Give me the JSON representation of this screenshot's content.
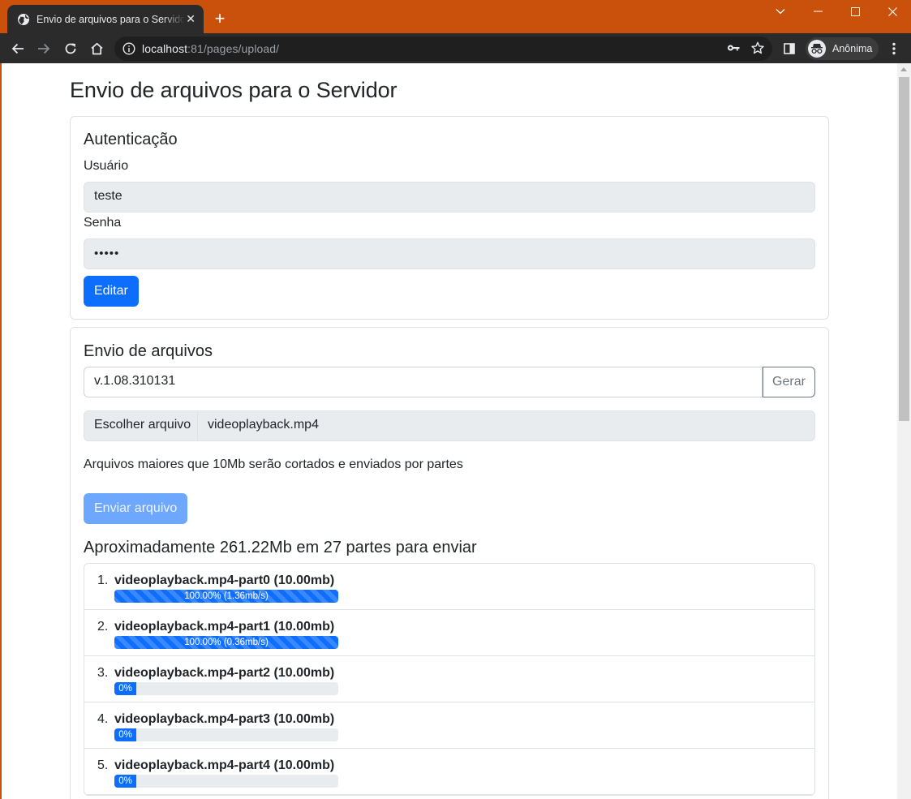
{
  "browser": {
    "tab_title": "Envio de arquivos para o Servidor",
    "tab_close": "✕",
    "new_tab": "+",
    "url_host": "localhost",
    "url_rest": ":81/pages/upload/",
    "profile_label": "Anônima",
    "theme_color": "#c9510c"
  },
  "page": {
    "title": "Envio de arquivos para o Servidor"
  },
  "auth": {
    "heading": "Autenticação",
    "user_label": "Usuário",
    "user_value": "teste",
    "password_label": "Senha",
    "password_value": "•••••",
    "edit_button": "Editar"
  },
  "upload": {
    "heading": "Envio de arquivos",
    "version_value": "v.1.08.310131",
    "generate_button": "Gerar",
    "choose_file_button": "Escolher arquivo",
    "file_name": "videoplayback.mp4",
    "help_text": "Arquivos maiores que 10Mb serão cortados e enviados por partes",
    "send_button": "Enviar arquivo",
    "summary": "Aproximadamente 261.22Mb em 27 partes para enviar",
    "parts": [
      {
        "num": "1.",
        "name": "videoplayback.mp4-part0 (10.00mb)",
        "progress": 100,
        "progress_label": "100.00% (1.36mb/s)"
      },
      {
        "num": "2.",
        "name": "videoplayback.mp4-part1 (10.00mb)",
        "progress": 100,
        "progress_label": "100.00% (0.36mb/s)"
      },
      {
        "num": "3.",
        "name": "videoplayback.mp4-part2 (10.00mb)",
        "progress": 0,
        "progress_label": "0%"
      },
      {
        "num": "4.",
        "name": "videoplayback.mp4-part3 (10.00mb)",
        "progress": 0,
        "progress_label": "0%"
      },
      {
        "num": "5.",
        "name": "videoplayback.mp4-part4 (10.00mb)",
        "progress": 0,
        "progress_label": "0%"
      }
    ]
  },
  "colors": {
    "primary": "#0d6efd",
    "primary_disabled": "#6ea8fe",
    "readonly_bg": "#e9ecef"
  }
}
